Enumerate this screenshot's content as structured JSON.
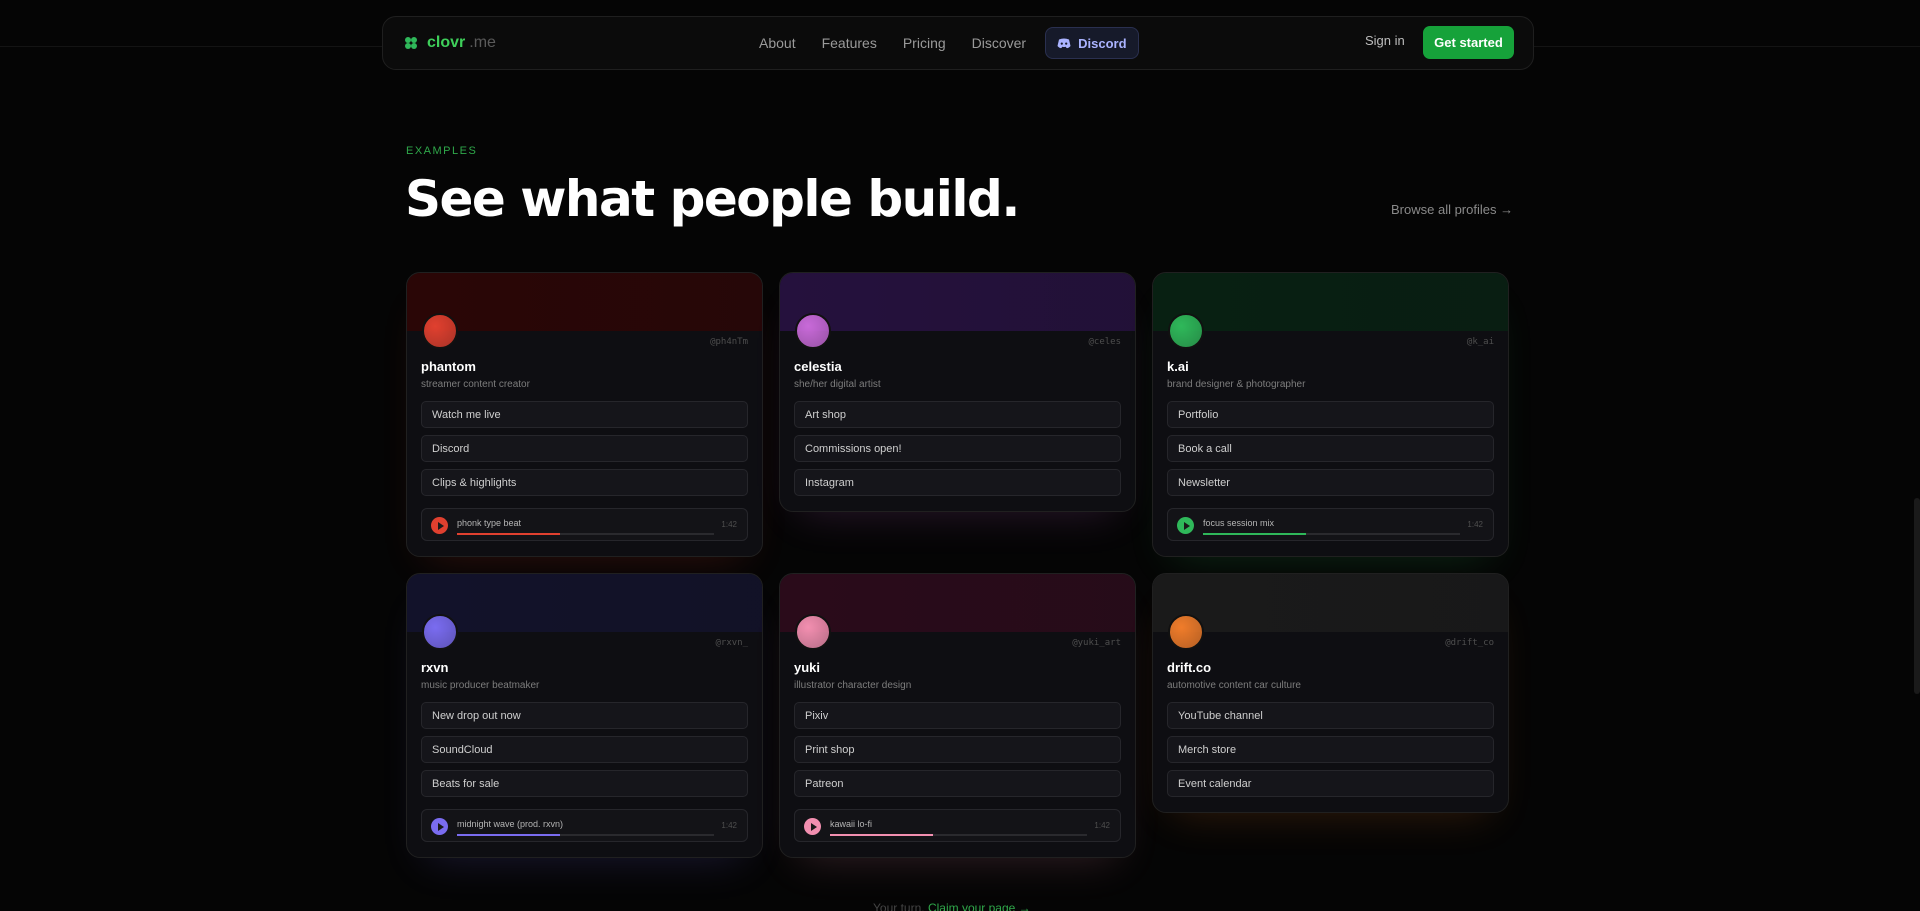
{
  "nav": {
    "brand_name": "clovr",
    "brand_tld": ".me",
    "items": [
      "About",
      "Features",
      "Pricing",
      "Discover"
    ],
    "discord_label": "Discord",
    "signin_label": "Sign in",
    "cta_label": "Get started"
  },
  "header": {
    "eyebrow": "EXAMPLES",
    "title": "See what people build.",
    "browse_label": "Browse all profiles →"
  },
  "cards": [
    {
      "handle": "@ph4nTm",
      "name": "phantom",
      "bio": "streamer content creator",
      "links": [
        "Watch me live",
        "Discord",
        "Clips & highlights"
      ],
      "player": {
        "track": "phonk type beat",
        "time": "1:42"
      },
      "accent": "#e0402f",
      "banner": "#2a0606"
    },
    {
      "handle": "@celes",
      "name": "celestia",
      "bio": "she/her digital artist",
      "links": [
        "Art shop",
        "Commissions open!",
        "Instagram"
      ],
      "accent": "#c86ad8",
      "banner": "#25113d"
    },
    {
      "handle": "@k_ai",
      "name": "k.ai",
      "bio": "brand designer & photographer",
      "links": [
        "Portfolio",
        "Book a call",
        "Newsletter"
      ],
      "player": {
        "track": "focus session mix",
        "time": "1:42"
      },
      "accent": "#2fb85a",
      "banner": "#082012"
    },
    {
      "handle": "@rxvn_",
      "name": "rxvn",
      "bio": "music producer beatmaker",
      "links": [
        "New drop out now",
        "SoundCloud",
        "Beats for sale"
      ],
      "player": {
        "track": "midnight wave (prod. rxvn)",
        "time": "1:42"
      },
      "accent": "#7a6cf0",
      "banner": "#12122a"
    },
    {
      "handle": "@yuki_art",
      "name": "yuki",
      "bio": "illustrator character design",
      "links": [
        "Pixiv",
        "Print shop",
        "Patreon"
      ],
      "player": {
        "track": "kawaii lo-fi",
        "time": "1:42"
      },
      "accent": "#f28fb0",
      "banner": "#2a0b1a"
    },
    {
      "handle": "@drift_co",
      "name": "drift.co",
      "bio": "automotive content car culture",
      "links": [
        "YouTube channel",
        "Merch store",
        "Event calendar"
      ],
      "accent": "#f07c2a",
      "banner": "#1a1a1a"
    }
  ],
  "footer": {
    "turn": "Your turn.",
    "claim": "Claim your page →"
  }
}
